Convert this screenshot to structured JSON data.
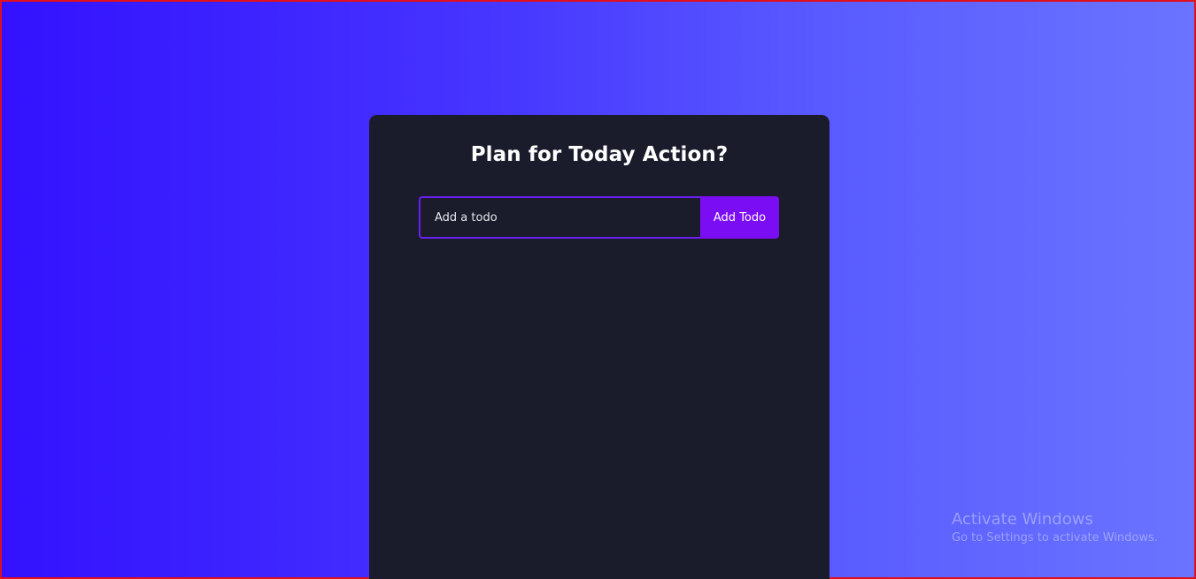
{
  "todo": {
    "title": "Plan for Today Action?",
    "input": {
      "placeholder": "Add a todo",
      "value": ""
    },
    "add_button_label": "Add Todo"
  },
  "watermark": {
    "title": "Activate Windows",
    "subtitle": "Go to Settings to activate Windows."
  },
  "colors": {
    "card_background": "#1a1c2b",
    "accent": "#7b0df5",
    "input_border": "#6b1ff2",
    "gradient_start": "#3311ff",
    "gradient_end": "#6a74ff"
  }
}
